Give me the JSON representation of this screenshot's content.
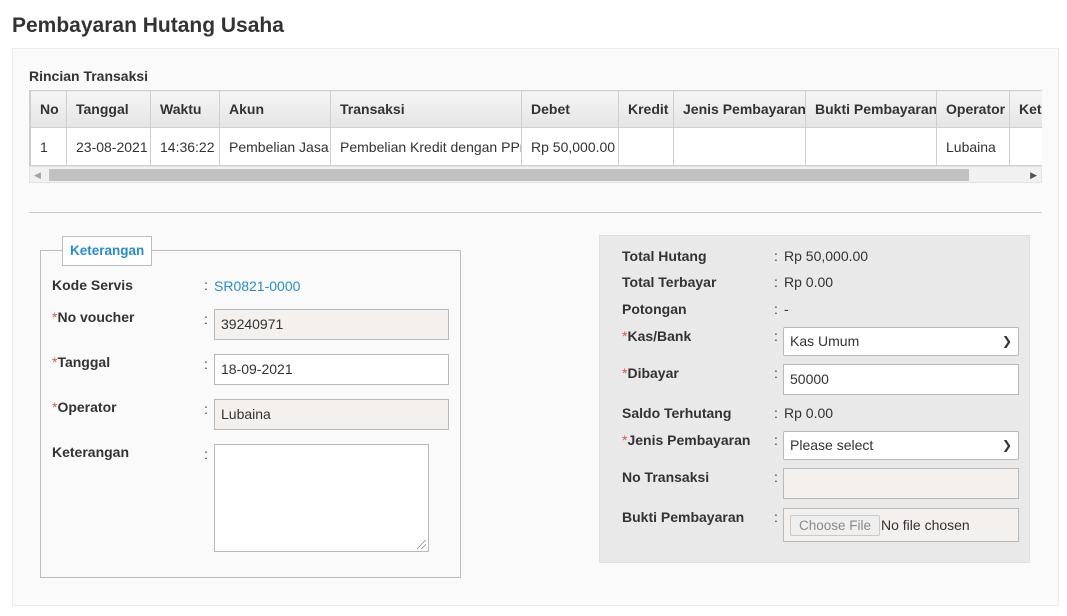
{
  "page": {
    "title": "Pembayaran Hutang Usaha"
  },
  "rincian": {
    "title": "Rincian Transaksi",
    "columns": [
      "No",
      "Tanggal",
      "Waktu",
      "Akun",
      "Transaksi",
      "Debet",
      "Kredit",
      "Jenis Pembayaran",
      "Bukti Pembayaran",
      "Operator",
      "Keterangan"
    ],
    "rows": [
      [
        "1",
        "23-08-2021",
        "14:36:22",
        "Pembelian Jasa",
        "Pembelian Kredit dengan PPn",
        "Rp 50,000.00",
        "",
        "",
        "",
        "Lubaina",
        ""
      ]
    ]
  },
  "keterangan_form": {
    "legend": "Keterangan",
    "kode_servis_label": "Kode Servis",
    "kode_servis_value": "SR0821-0000",
    "no_voucher_label": "No voucher",
    "no_voucher_value": "39240971",
    "tanggal_label": "Tanggal",
    "tanggal_value": "18-09-2021",
    "operator_label": "Operator",
    "operator_value": "Lubaina",
    "keterangan_label": "Keterangan",
    "keterangan_value": ""
  },
  "payment": {
    "total_hutang_label": "Total Hutang",
    "total_hutang_value": "Rp 50,000.00",
    "total_terbayar_label": "Total Terbayar",
    "total_terbayar_value": "Rp 0.00",
    "potongan_label": "Potongan",
    "potongan_value": "-",
    "kas_bank_label": "Kas/Bank",
    "kas_bank_value": "Kas Umum",
    "dibayar_label": "Dibayar",
    "dibayar_value": "50000",
    "saldo_label": "Saldo Terhutang",
    "saldo_value": "Rp 0.00",
    "jenis_label": "Jenis Pembayaran",
    "jenis_value": "Please select",
    "no_transaksi_label": "No Transaksi",
    "no_transaksi_value": "",
    "bukti_label": "Bukti Pembayaran",
    "choose_file_label": "Choose File",
    "no_file_text": "No file chosen"
  },
  "common": {
    "colon": ":",
    "required_mark": "*"
  },
  "icons": {
    "scroll_left": "triangle-left-icon",
    "scroll_right": "triangle-right-icon",
    "dropdown": "chevron-down-icon"
  }
}
